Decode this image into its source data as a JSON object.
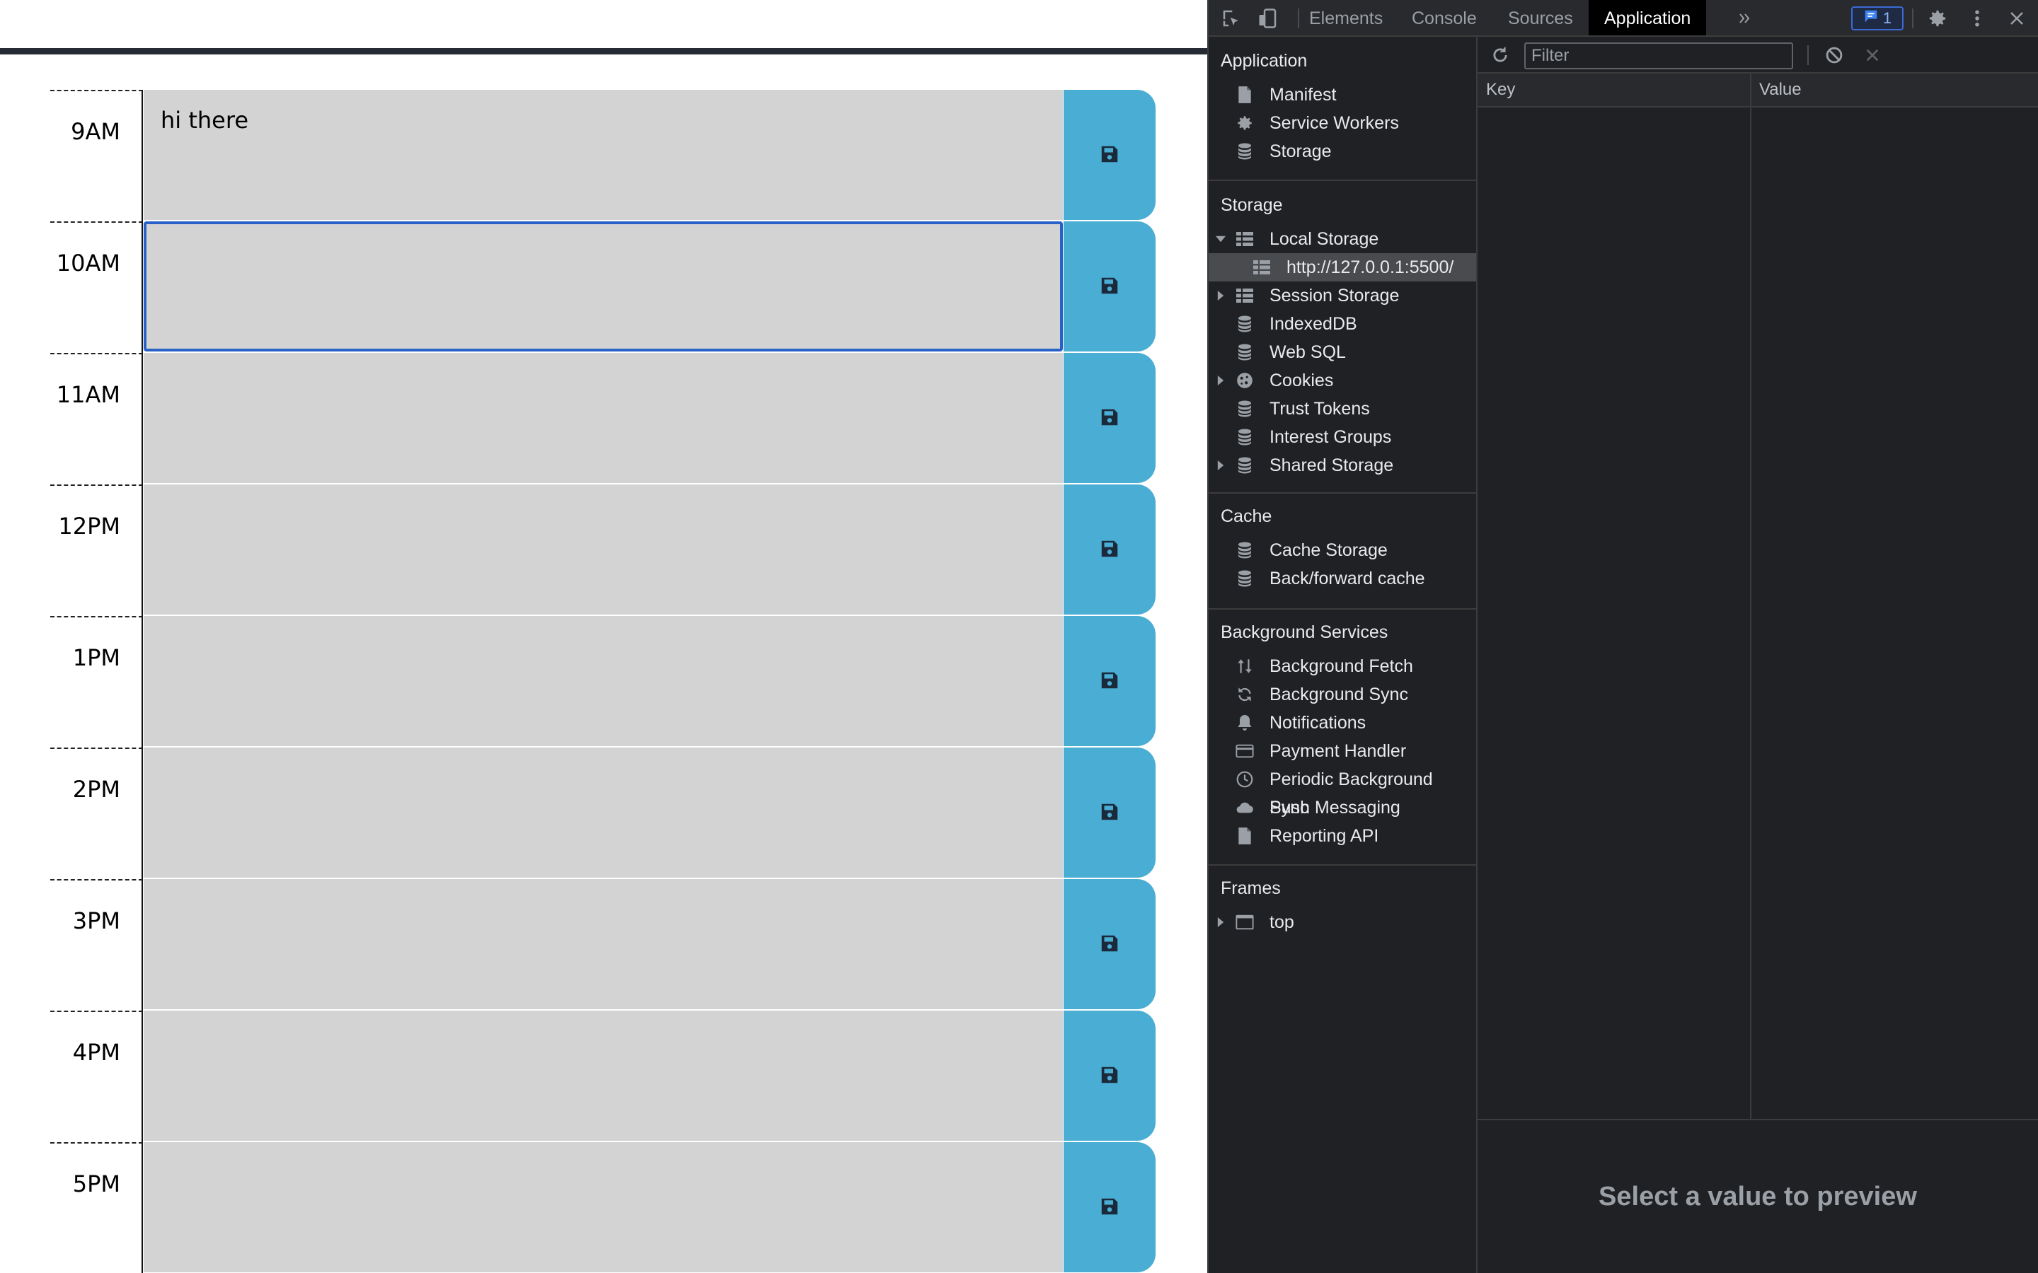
{
  "planner": {
    "rows": [
      {
        "hour": "9AM",
        "text": "hi there",
        "focused": false
      },
      {
        "hour": "10AM",
        "text": "",
        "focused": true
      },
      {
        "hour": "11AM",
        "text": "",
        "focused": false
      },
      {
        "hour": "12PM",
        "text": "",
        "focused": false
      },
      {
        "hour": "1PM",
        "text": "",
        "focused": false
      },
      {
        "hour": "2PM",
        "text": "",
        "focused": false
      },
      {
        "hour": "3PM",
        "text": "",
        "focused": false
      },
      {
        "hour": "4PM",
        "text": "",
        "focused": false
      },
      {
        "hour": "5PM",
        "text": "",
        "focused": false
      }
    ],
    "save_icon": "floppy-disk-icon",
    "colors": {
      "row_bg": "#d3d3d3",
      "save_bg": "#4aadd4",
      "focus_border": "#2962c7"
    }
  },
  "devtools": {
    "tabs": [
      {
        "label": "Elements",
        "active": false
      },
      {
        "label": "Console",
        "active": false
      },
      {
        "label": "Sources",
        "active": false
      },
      {
        "label": "Application",
        "active": true
      }
    ],
    "issues_count": "1",
    "sidebar": {
      "application": {
        "title": "Application",
        "items": [
          {
            "label": "Manifest",
            "icon": "file-icon"
          },
          {
            "label": "Service Workers",
            "icon": "gear-icon"
          },
          {
            "label": "Storage",
            "icon": "database-icon"
          }
        ]
      },
      "storage": {
        "title": "Storage",
        "items": [
          {
            "label": "Local Storage",
            "icon": "table-icon",
            "expander": "expanded"
          },
          {
            "label": "http://127.0.0.1:5500/",
            "icon": "table-icon",
            "selected": true
          },
          {
            "label": "Session Storage",
            "icon": "table-icon",
            "expander": "collapsed"
          },
          {
            "label": "IndexedDB",
            "icon": "database-icon"
          },
          {
            "label": "Web SQL",
            "icon": "database-icon"
          },
          {
            "label": "Cookies",
            "icon": "cookie-icon",
            "expander": "collapsed"
          },
          {
            "label": "Trust Tokens",
            "icon": "database-icon"
          },
          {
            "label": "Interest Groups",
            "icon": "database-icon"
          },
          {
            "label": "Shared Storage",
            "icon": "database-icon",
            "expander": "collapsed"
          }
        ]
      },
      "cache": {
        "title": "Cache",
        "items": [
          {
            "label": "Cache Storage",
            "icon": "database-icon"
          },
          {
            "label": "Back/forward cache",
            "icon": "database-icon"
          }
        ]
      },
      "background": {
        "title": "Background Services",
        "items": [
          {
            "label": "Background Fetch",
            "icon": "up-down-arrows-icon"
          },
          {
            "label": "Background Sync",
            "icon": "sync-icon"
          },
          {
            "label": "Notifications",
            "icon": "bell-icon"
          },
          {
            "label": "Payment Handler",
            "icon": "credit-card-icon"
          },
          {
            "label": "Periodic Background Sync",
            "icon": "clock-icon"
          },
          {
            "label": "Push Messaging",
            "icon": "cloud-icon"
          },
          {
            "label": "Reporting API",
            "icon": "file-icon"
          }
        ]
      },
      "frames": {
        "title": "Frames",
        "items": [
          {
            "label": "top",
            "icon": "frame-icon",
            "expander": "collapsed"
          }
        ]
      }
    },
    "filter": {
      "placeholder": "Filter",
      "value": ""
    },
    "table": {
      "columns": [
        "Key",
        "Value"
      ],
      "rows": []
    },
    "preview_text": "Select a value to preview",
    "colors": {
      "panel_bg": "#202124",
      "tabbar_bg": "#292a2d",
      "selected_row_bg": "#4a4b4f"
    }
  }
}
